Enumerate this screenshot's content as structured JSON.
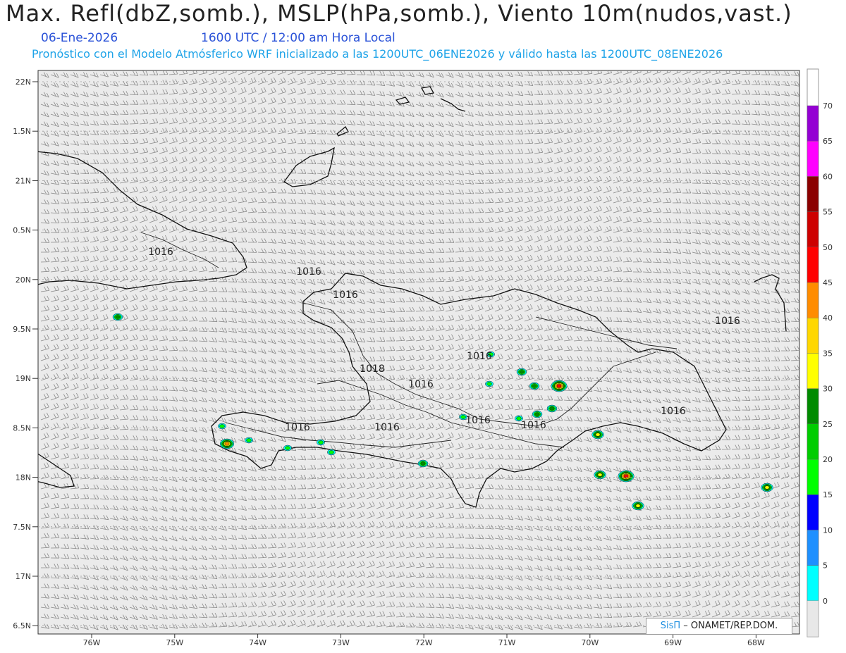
{
  "header": {
    "title": "Max. Refl(dbZ,somb.), MSLP(hPa,somb.), Viento 10m(nudos,vast.)",
    "date": "06-Ene-2026",
    "time": "1600 UTC / 12:00 am Hora Local",
    "forecast": "Pronóstico con el Modelo Atmósferico WRF inicializado a las 1200UTC_06ENE2026 y válido hasta las  1200UTC_08ENE2026"
  },
  "lat_labels": [
    "22N",
    "1.5N",
    "21N",
    "0.5N",
    "20N",
    "9.5N",
    "19N",
    "8.5N",
    "18N",
    "7.5N",
    "17N",
    "6.5N"
  ],
  "lon_labels": [
    "76W",
    "75W",
    "74W",
    "73W",
    "72W",
    "71W",
    "70W",
    "69W",
    "68W"
  ],
  "isobar_labels": [
    "1016",
    "1016",
    "1016",
    "1018",
    "1016",
    "1016",
    "1016",
    "1016",
    "1016",
    "1016",
    "1016",
    "1016"
  ],
  "colorbar": {
    "levels": [
      "0",
      "5",
      "10",
      "15",
      "20",
      "25",
      "30",
      "35",
      "40",
      "45",
      "50",
      "55",
      "60",
      "65",
      "70"
    ],
    "colors": [
      "#00ffff",
      "#1e90ff",
      "#0000ff",
      "#00ff00",
      "#00cd00",
      "#008b00",
      "#ffff00",
      "#ffd700",
      "#ff8c00",
      "#ff0000",
      "#cd0000",
      "#8b0000",
      "#ff00ff",
      "#9400d3"
    ]
  },
  "credit": {
    "brand": "SisΠ",
    "text": "– ONAMET/REP.DOM."
  }
}
